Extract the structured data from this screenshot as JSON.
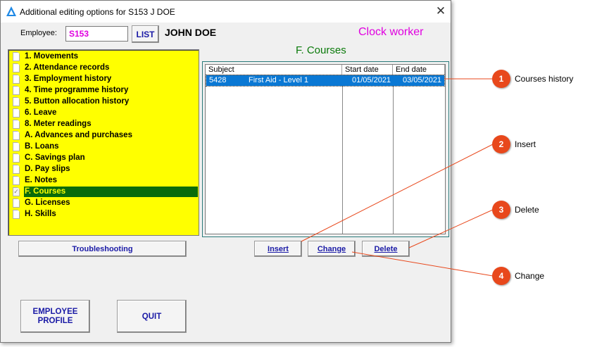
{
  "window": {
    "title": "Additional editing options for S153 J DOE",
    "close_glyph": "✕"
  },
  "employee": {
    "label": "Employee:",
    "id": "S153",
    "list_button": "LIST",
    "name": "JOHN DOE",
    "worker_type": "Clock worker"
  },
  "menu": {
    "items": [
      {
        "label": "1. Movements"
      },
      {
        "label": "2. Attendance records"
      },
      {
        "label": "3. Employment history"
      },
      {
        "label": "4. Time programme history"
      },
      {
        "label": "5. Button allocation history"
      },
      {
        "label": "6. Leave"
      },
      {
        "label": "8. Meter readings"
      },
      {
        "label": "A. Advances and purchases"
      },
      {
        "label": "B. Loans"
      },
      {
        "label": "C. Savings plan"
      },
      {
        "label": "D. Pay slips"
      },
      {
        "label": "E. Notes"
      },
      {
        "label": "F. Courses",
        "selected": true
      },
      {
        "label": "G. Licenses"
      },
      {
        "label": "H. Skills"
      }
    ]
  },
  "buttons": {
    "troubleshooting": "Troubleshooting",
    "employee_profile": "EMPLOYEE PROFILE",
    "quit": "QUIT",
    "insert": "Insert",
    "change": "Change",
    "delete": "Delete"
  },
  "courses": {
    "title": "F. Courses",
    "columns": [
      "Subject",
      "Start date",
      "End date"
    ],
    "rows": [
      {
        "code": "5428",
        "subject": "First Aid - Level 1",
        "start": "01/05/2021",
        "end": "03/05/2021"
      }
    ]
  },
  "callouts": [
    {
      "number": "1",
      "label": "Courses history"
    },
    {
      "number": "2",
      "label": "Insert"
    },
    {
      "number": "3",
      "label": "Delete"
    },
    {
      "number": "4",
      "label": "Change"
    }
  ],
  "colors": {
    "menu_background": "#ffff00",
    "menu_selected": "#0a6b0a",
    "accent_magenta": "#e000e0",
    "section_green": "#0a7a0a",
    "selection_blue": "#0a78d4",
    "callout_orange": "#e8481c"
  }
}
